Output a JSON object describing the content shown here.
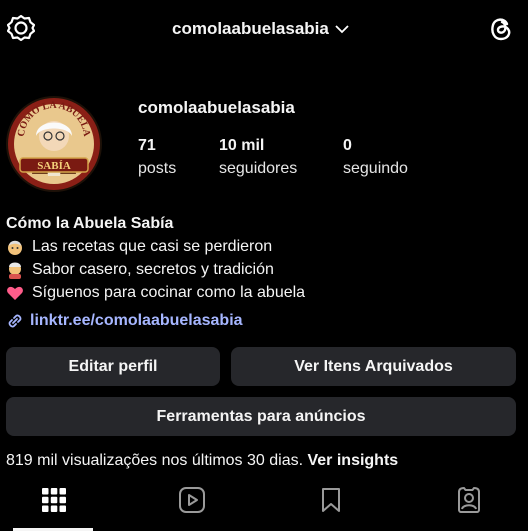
{
  "header": {
    "username": "comolaabuelasabia"
  },
  "profile": {
    "username": "comolaabuelasabia",
    "avatar_text_top": "COMO LA ABUELA",
    "avatar_text_bottom": "SABÍA",
    "stats": [
      {
        "value": "71",
        "label": "posts"
      },
      {
        "value": "10 mil",
        "label": "seguidores"
      },
      {
        "value": "0",
        "label": "seguindo"
      }
    ]
  },
  "bio": {
    "name": "Cómo la Abuela Sabía",
    "lines": [
      {
        "icon": "grandmother-emoji-icon",
        "text": "Las recetas que casi se perdieron"
      },
      {
        "icon": "cooking-grandmother-emoji-icon",
        "text": "Sabor casero, secretos y tradición"
      },
      {
        "icon": "heart-emoji-icon",
        "text": "Síguenos para cocinar como la abuela"
      }
    ],
    "link": "linktr.ee/comolaabuelasabia"
  },
  "buttons": {
    "edit_profile": "Editar perfil",
    "archived": "Ver Itens Arquivados",
    "ad_tools": "Ferramentas para anúncios"
  },
  "insights": {
    "text": "819 mil visualizações nos últimos 30 dias.",
    "link": "Ver insights"
  },
  "tabs": [
    "grid-icon",
    "reels-icon",
    "saved-icon",
    "tagged-icon"
  ],
  "colors": {
    "background": "#000000",
    "button": "#26272b",
    "link": "#a6b6ff"
  }
}
